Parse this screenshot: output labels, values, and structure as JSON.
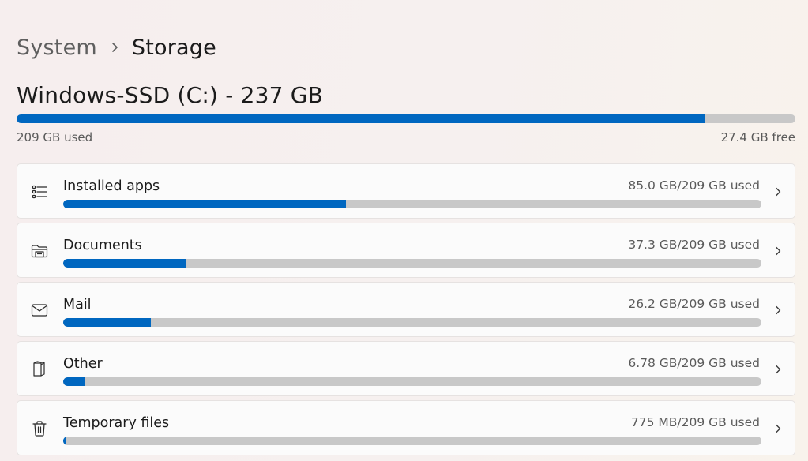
{
  "breadcrumb": {
    "parent": "System",
    "current": "Storage"
  },
  "drive": {
    "title": "Windows-SSD (C:) - 237 GB",
    "used_label": "209 GB used",
    "free_label": "27.4 GB free",
    "used_fraction": 0.884
  },
  "colors": {
    "accent": "#0067c0",
    "track": "#c8c8c8"
  },
  "categories": [
    {
      "label": "Installed apps",
      "usage": "85.0 GB/209 GB used",
      "fraction": 0.405,
      "icon": "list-icon"
    },
    {
      "label": "Documents",
      "usage": "37.3 GB/209 GB used",
      "fraction": 0.177,
      "icon": "folder-icon"
    },
    {
      "label": "Mail",
      "usage": "26.2 GB/209 GB used",
      "fraction": 0.125,
      "icon": "mail-icon"
    },
    {
      "label": "Other",
      "usage": "6.78 GB/209 GB used",
      "fraction": 0.032,
      "icon": "other-files-icon"
    },
    {
      "label": "Temporary files",
      "usage": "775 MB/209 GB used",
      "fraction": 0.004,
      "icon": "trash-icon"
    }
  ]
}
